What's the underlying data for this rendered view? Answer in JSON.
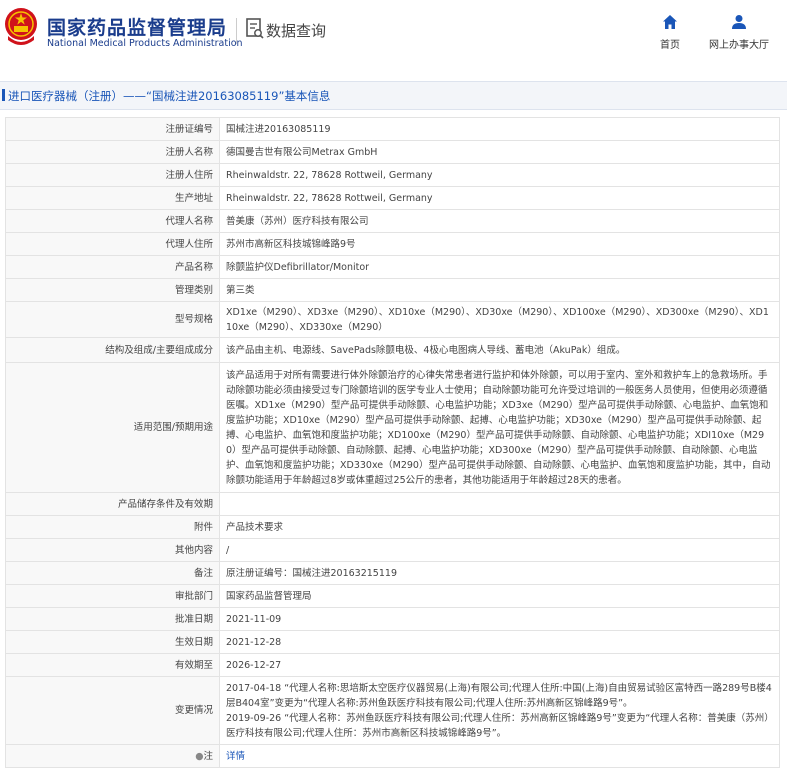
{
  "header": {
    "site_title_cn": "国家药品监督管理局",
    "site_title_en": "National Medical Products Administration",
    "query_label": "数据查询",
    "nav": [
      {
        "label": "首页",
        "icon": "home-icon"
      },
      {
        "label": "网上办事大厅",
        "icon": "user-icon"
      }
    ]
  },
  "breadcrumb": "进口医疗器械（注册）——“国械注进20163085119”基本信息",
  "rows": [
    {
      "label": "注册证编号",
      "value": "国械注进20163085119"
    },
    {
      "label": "注册人名称",
      "value": "德国曼吉世有限公司Metrax GmbH"
    },
    {
      "label": "注册人住所",
      "value": "Rheinwaldstr. 22, 78628 Rottweil, Germany"
    },
    {
      "label": "生产地址",
      "value": "Rheinwaldstr. 22, 78628 Rottweil, Germany"
    },
    {
      "label": "代理人名称",
      "value": "普美康（苏州）医疗科技有限公司"
    },
    {
      "label": "代理人住所",
      "value": "苏州市高新区科技城锦峰路9号"
    },
    {
      "label": "产品名称",
      "value": "除颤监护仪Defibrillator/Monitor"
    },
    {
      "label": "管理类别",
      "value": "第三类"
    },
    {
      "label": "型号规格",
      "value": "XD1xe（M290）、XD3xe（M290）、XD10xe（M290）、XD30xe（M290）、XD100xe（M290）、XD300xe（M290）、XD110xe（M290）、XD330xe（M290）"
    },
    {
      "label": "结构及组成/主要组成成分",
      "value": "该产品由主机、电源线、SavePads除颤电极、4极心电图病人导线、蓄电池（AkuPak）组成。"
    },
    {
      "label": "适用范围/预期用途",
      "value": "该产品适用于对所有需要进行体外除颤治疗的心律失常患者进行监护和体外除颤，可以用于室内、室外和救护车上的急救场所。手动除颤功能必须由接受过专门除颤培训的医学专业人士使用；自动除颤功能可允许受过培训的一般医务人员使用，但使用必须遵循医嘱。XD1xe（M290）型产品可提供手动除颤、心电监护功能；XD3xe（M290）型产品可提供手动除颤、心电监护、血氧饱和度监护功能；XD10xe（M290）型产品可提供手动除颤、起搏、心电监护功能；XD30xe（M290）型产品可提供手动除颤、起搏、心电监护、血氧饱和度监护功能；XD100xe（M290）型产品可提供手动除颤、自动除颤、心电监护功能；XDI10xe（M290）型产品可提供手动除颤、自动除颤、起搏、心电监护功能；XD300xe（M290）型产品可提供手动除颤、自动除颤、心电监护、血氧饱和度监护功能；XD330xe（M290）型产品可提供手动除颤、自动除颤、心电监护、血氧饱和度监护功能，其中，自动除颤功能适用于年龄超过8岁或体重超过25公斤的患者，其他功能适用于年龄超过28天的患者。"
    },
    {
      "label": "产品储存条件及有效期",
      "value": ""
    },
    {
      "label": "附件",
      "value": "产品技术要求"
    },
    {
      "label": "其他内容",
      "value": "/"
    },
    {
      "label": "备注",
      "value": "原注册证编号：国械注进20163215119"
    },
    {
      "label": "审批部门",
      "value": "国家药品监督管理局"
    },
    {
      "label": "批准日期",
      "value": "2021-11-09"
    },
    {
      "label": "生效日期",
      "value": "2021-12-28"
    },
    {
      "label": "有效期至",
      "value": "2026-12-27"
    }
  ],
  "change_history": {
    "label": "变更情况",
    "entries": [
      "2017-04-18 “代理人名称:思培斯太空医疗仪器贸易(上海)有限公司;代理人住所:中国(上海)自由贸易试验区富特西一路289号B楼4层B404室”变更为“代理人名称:苏州鱼跃医疗科技有限公司;代理人住所:苏州高新区锦峰路9号”。",
      "2019-09-26 “代理人名称：苏州鱼跃医疗科技有限公司;代理人住所：苏州高新区锦峰路9号”变更为“代理人名称：普美康（苏州）医疗科技有限公司;代理人住所：苏州市高新区科技城锦峰路9号”。"
    ]
  },
  "note": {
    "label": "注",
    "link_text": "详情"
  },
  "colors": {
    "brand_blue": "#1a3c8c",
    "link_blue": "#1a56b8",
    "label_bg": "#f8f8f8",
    "border": "#e3e3e3"
  }
}
